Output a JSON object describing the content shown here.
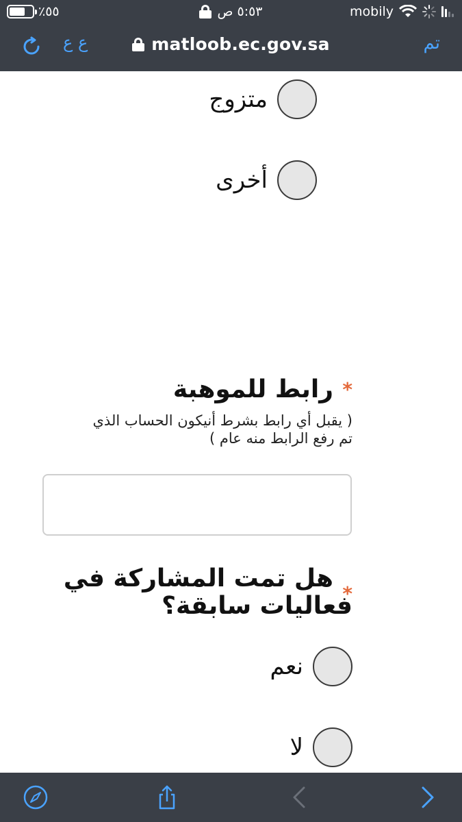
{
  "status_bar": {
    "battery_percent": "٪٥٥",
    "time": "٥:٥٣ ص",
    "carrier": "mobily"
  },
  "browser": {
    "url": "matloob.ec.gov.sa",
    "done_label": "تم",
    "text_size_label": "ع ع"
  },
  "form": {
    "marital_options": [
      {
        "label": "متزوج",
        "selected": false
      },
      {
        "label": "أخرى",
        "selected": false
      }
    ],
    "talent_link": {
      "question": "رابط للموهبة",
      "required_mark": "*",
      "hint_line1": "( يقبل أي رابط بشرط أنيكون الحساب الذي",
      "hint_line2": "تم رفع الرابط منه عام )",
      "value": "",
      "placeholder": ""
    },
    "previous_participation": {
      "question_line1": "هل تمت المشاركة في",
      "question_line2": "فعاليات سابقة؟",
      "required_mark": "*",
      "options": [
        {
          "label": "نعم",
          "selected": false
        },
        {
          "label": "لا",
          "selected": false
        }
      ]
    }
  },
  "toolbar": {
    "icons": [
      "compass-icon",
      "share-icon",
      "back-arrow-icon",
      "forward-arrow-icon"
    ]
  },
  "colors": {
    "chrome_bg": "#3a3f47",
    "accent_blue": "#4aa3ff",
    "required_star": "#e46a3c"
  }
}
